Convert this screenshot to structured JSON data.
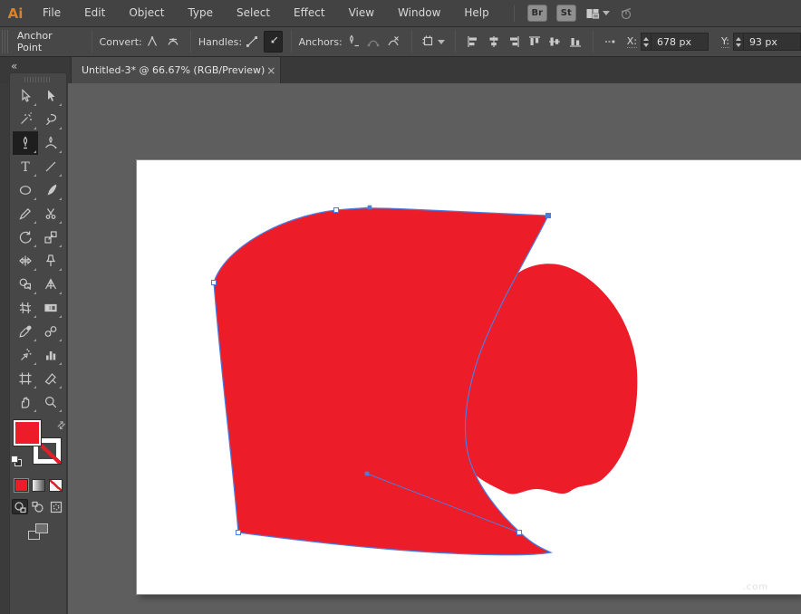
{
  "colors": {
    "red": "#EC1C28",
    "selection_blue": "#4C7CE0",
    "canvas": "#5E5E5E",
    "panel": "#474747",
    "bar": "#434343"
  },
  "menubar": {
    "logo": "Ai",
    "items": [
      "File",
      "Edit",
      "Object",
      "Type",
      "Select",
      "Effect",
      "View",
      "Window",
      "Help"
    ],
    "bridge_button": "Br",
    "stock_button": "St"
  },
  "controlbar": {
    "title": "Anchor Point",
    "convert_label": "Convert:",
    "handles_label": "Handles:",
    "anchors_label": "Anchors:",
    "x_label": "X:",
    "x_value": "678 px",
    "y_label": "Y:",
    "y_value": "93 px"
  },
  "docbar": {
    "collapse": "«",
    "tab_title": "Untitled-3* @ 66.67% (RGB/Preview)",
    "close": "×"
  },
  "toolbar": {
    "selected_tool": "pen",
    "tools": [
      {
        "id": "selection",
        "label": "Selection Tool"
      },
      {
        "id": "direct-selection",
        "label": "Direct Selection Tool"
      },
      {
        "id": "magic-wand",
        "label": "Magic Wand Tool"
      },
      {
        "id": "lasso",
        "label": "Lasso Tool"
      },
      {
        "id": "pen",
        "label": "Pen Tool"
      },
      {
        "id": "curvature",
        "label": "Curvature Tool"
      },
      {
        "id": "type",
        "label": "Type Tool"
      },
      {
        "id": "line-segment",
        "label": "Line Segment Tool"
      },
      {
        "id": "ellipse",
        "label": "Ellipse Tool"
      },
      {
        "id": "paintbrush",
        "label": "Paintbrush Tool"
      },
      {
        "id": "pencil",
        "label": "Pencil Tool"
      },
      {
        "id": "scissors",
        "label": "Scissors Tool"
      },
      {
        "id": "rotate",
        "label": "Rotate Tool"
      },
      {
        "id": "scale",
        "label": "Scale Tool"
      },
      {
        "id": "width",
        "label": "Width Tool"
      },
      {
        "id": "puppet-warp",
        "label": "Puppet Warp Tool"
      },
      {
        "id": "shape-builder",
        "label": "Shape Builder Tool"
      },
      {
        "id": "perspective-grid",
        "label": "Perspective Grid Tool"
      },
      {
        "id": "mesh",
        "label": "Mesh Tool"
      },
      {
        "id": "gradient",
        "label": "Gradient Tool"
      },
      {
        "id": "eyedropper",
        "label": "Eyedropper Tool"
      },
      {
        "id": "blend",
        "label": "Blend Tool"
      },
      {
        "id": "symbol-sprayer",
        "label": "Symbol Sprayer Tool"
      },
      {
        "id": "column-graph",
        "label": "Column Graph Tool"
      },
      {
        "id": "artboard",
        "label": "Artboard Tool"
      },
      {
        "id": "slice",
        "label": "Slice Tool"
      },
      {
        "id": "hand",
        "label": "Hand Tool"
      },
      {
        "id": "zoom",
        "label": "Zoom Tool"
      }
    ],
    "swap_glyph": "⇄",
    "fill_color": "#EC1C28",
    "stroke_style": "none"
  },
  "artboard": {
    "shape_fill": "#EC1C28",
    "watermark": ".com"
  }
}
